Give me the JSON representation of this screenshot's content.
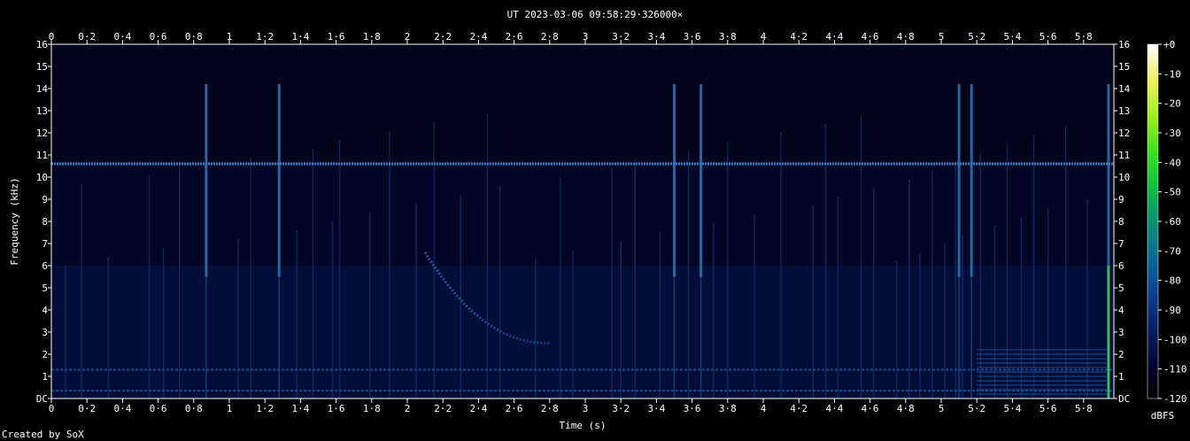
{
  "chart_data": {
    "type": "heatmap",
    "title": "UT 2023-03-06 09:58:29·326000×",
    "xlabel": "Time (s)",
    "ylabel": "Frequency (kHz)",
    "xlim": [
      0,
      5.97
    ],
    "ylim": [
      0,
      16
    ],
    "x_ticks": [
      "0",
      "0·2",
      "0·4",
      "0·6",
      "0·8",
      "1",
      "1·2",
      "1·4",
      "1·6",
      "1·8",
      "2",
      "2·2",
      "2·4",
      "2·6",
      "2·8",
      "3",
      "3·2",
      "3·4",
      "3·6",
      "3·8",
      "4",
      "4·2",
      "4·4",
      "4·6",
      "4·8",
      "5",
      "5·2",
      "5·4",
      "5·6",
      "5·8"
    ],
    "y_ticks": [
      "DC",
      "1",
      "2",
      "3",
      "4",
      "5",
      "6",
      "7",
      "8",
      "9",
      "10",
      "11",
      "12",
      "13",
      "14",
      "15",
      "16"
    ],
    "colorbar": {
      "label": "dBFS",
      "ticks": [
        "+0",
        "-10",
        "-20",
        "-30",
        "-40",
        "-50",
        "-60",
        "-70",
        "-80",
        "-90",
        "-100",
        "-110",
        "-120"
      ],
      "range": [
        -120,
        0
      ]
    },
    "features": {
      "horizontal_lines_khz": [
        10.6,
        1.3,
        0.35
      ],
      "vertical_bursts_s": [
        0.87,
        1.28,
        3.5,
        3.65,
        5.1,
        5.17,
        5.94
      ],
      "sweep": {
        "start_s": 2.1,
        "end_s": 2.8,
        "start_khz": 6.6,
        "end_khz": 2.5
      }
    },
    "footer": "Created by SoX"
  }
}
